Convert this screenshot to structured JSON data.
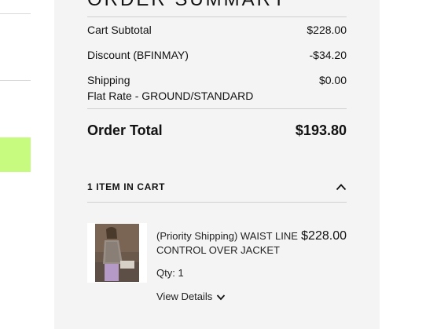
{
  "colors": {
    "panel_bg": "#f4f4f4",
    "accent_green": "#c6fb7f",
    "divider": "#cfcfcf",
    "text": "#111111"
  },
  "summary": {
    "title": "ORDER SUMMARY",
    "subtotal_label": "Cart Subtotal",
    "subtotal_value": "$228.00",
    "discount_label": "Discount (BFINMAY)",
    "discount_value": "-$34.20",
    "shipping_label": "Shipping",
    "shipping_value": "$0.00",
    "shipping_method": "Flat Rate - GROUND/STANDARD",
    "total_label": "Order Total",
    "total_value": "$193.80"
  },
  "cart": {
    "heading": "1 ITEM IN CART",
    "toggle_icon": "chevron-up-icon",
    "items": [
      {
        "name": "(Priority Shipping) WAIST LINE CONTROL OVER JACKET",
        "price": "$228.00",
        "qty_label": "Qty:",
        "qty_value": "1",
        "view_details_label": "View Details",
        "view_details_icon": "chevron-down-icon"
      }
    ]
  }
}
